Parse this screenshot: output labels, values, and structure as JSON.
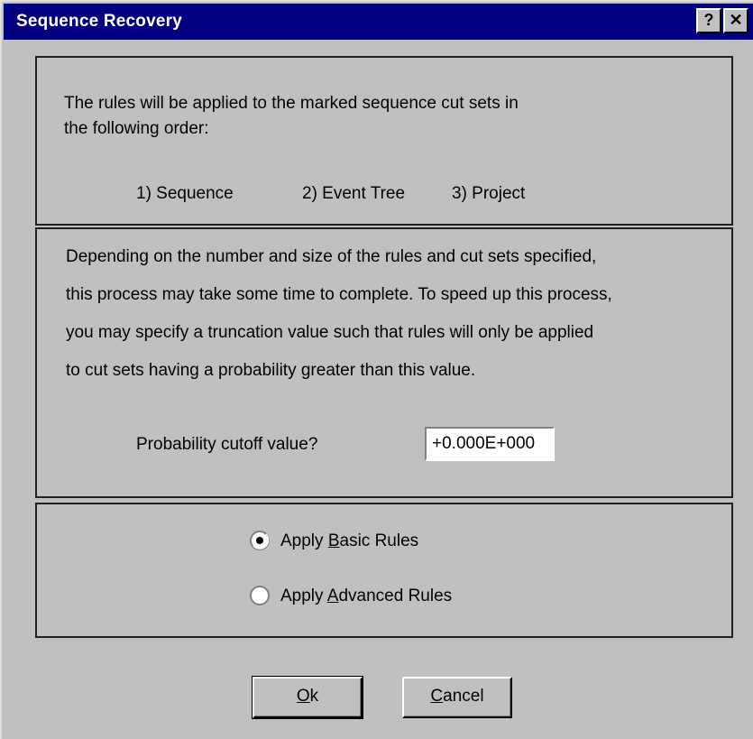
{
  "window": {
    "title": "Sequence Recovery",
    "help_label": "?",
    "close_label": "✕"
  },
  "order_panel": {
    "line1": "The rules will be applied to the marked sequence cut sets in",
    "line2": "the following order:",
    "step1": "1) Sequence",
    "step2": "2) Event Tree",
    "step3": "3) Project"
  },
  "cutoff_panel": {
    "line1": "Depending on the number and size of the rules and  cut  sets  specified,",
    "line2": "this process may take some time to complete.  To speed up this  process,",
    "line3": "you may specify a truncation value such that rules will only be  applied",
    "line4": "to cut sets having a probability greater than this value.",
    "cutoff_label": "Probability cutoff value?",
    "cutoff_value": "+0.000E+000"
  },
  "rules_panel": {
    "basic": {
      "prefix": "Apply ",
      "hotkey": "B",
      "rest": "asic Rules",
      "selected": true
    },
    "advanced": {
      "prefix": "Apply ",
      "hotkey": "A",
      "rest": "dvanced Rules",
      "selected": false
    }
  },
  "buttons": {
    "ok": {
      "hotkey": "O",
      "rest": "k"
    },
    "cancel": {
      "hotkey": "C",
      "rest": "ancel"
    }
  }
}
